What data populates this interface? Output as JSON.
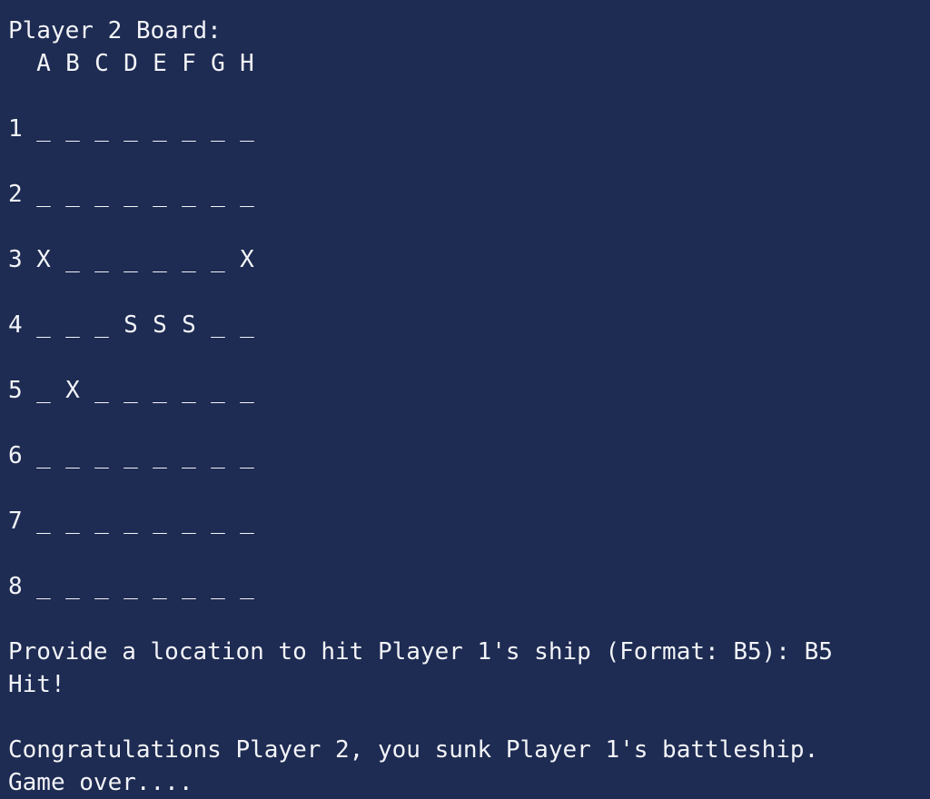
{
  "terminal": {
    "board_title": "Player 2 Board:",
    "columns": [
      "A",
      "B",
      "C",
      "D",
      "E",
      "F",
      "G",
      "H"
    ],
    "rows": [
      {
        "label": "1",
        "cells": [
          "_",
          "_",
          "_",
          "_",
          "_",
          "_",
          "_",
          "_"
        ]
      },
      {
        "label": "2",
        "cells": [
          "_",
          "_",
          "_",
          "_",
          "_",
          "_",
          "_",
          "_"
        ]
      },
      {
        "label": "3",
        "cells": [
          "X",
          "_",
          "_",
          "_",
          "_",
          "_",
          "_",
          "X"
        ]
      },
      {
        "label": "4",
        "cells": [
          "_",
          "_",
          "_",
          "S",
          "S",
          "S",
          "_",
          "_"
        ]
      },
      {
        "label": "5",
        "cells": [
          "_",
          "X",
          "_",
          "_",
          "_",
          "_",
          "_",
          "_"
        ]
      },
      {
        "label": "6",
        "cells": [
          "_",
          "_",
          "_",
          "_",
          "_",
          "_",
          "_",
          "_"
        ]
      },
      {
        "label": "7",
        "cells": [
          "_",
          "_",
          "_",
          "_",
          "_",
          "_",
          "_",
          "_"
        ]
      },
      {
        "label": "8",
        "cells": [
          "_",
          "_",
          "_",
          "_",
          "_",
          "_",
          "_",
          "_"
        ]
      }
    ],
    "prompt": "Provide a location to hit Player 1's ship (Format: B5): B5",
    "result": "Hit!",
    "congrats": "Congratulations Player 2, you sunk Player 1's battleship.",
    "game_over": "Game over...."
  },
  "colors": {
    "background": "#1e2b52",
    "text": "#f2f4f8"
  }
}
